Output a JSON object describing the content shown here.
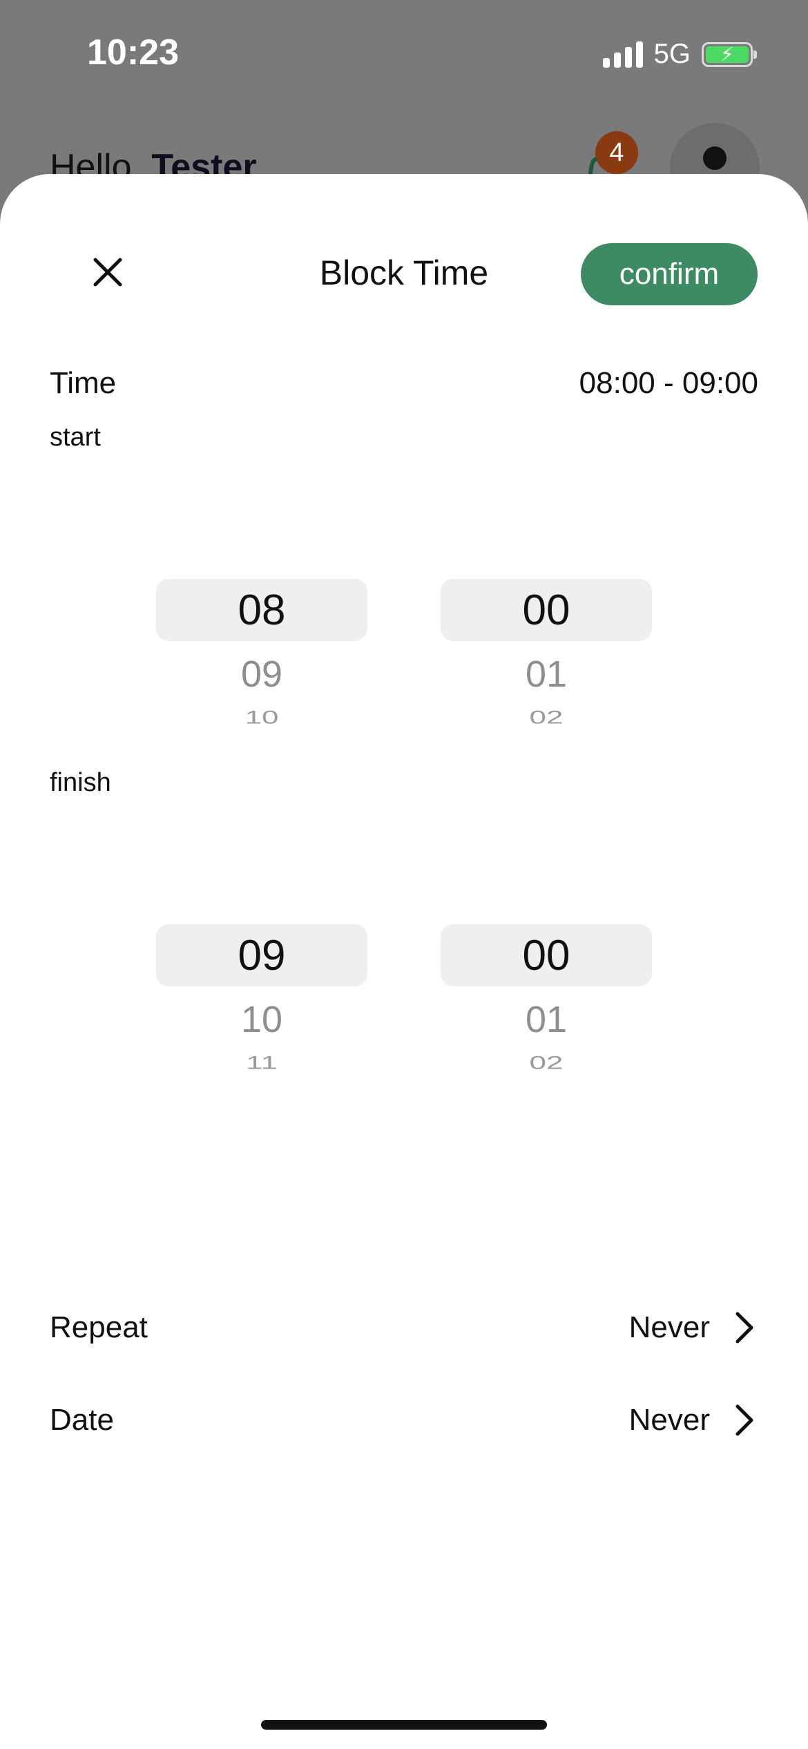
{
  "status_bar": {
    "time": "10:23",
    "network": "5G"
  },
  "background": {
    "greeting_prefix": "Hello, ",
    "greeting_name": "Tester",
    "notification_count": "4"
  },
  "sheet": {
    "title": "Block Time",
    "confirm_label": "confirm",
    "time_label": "Time",
    "time_range": "08:00 - 09:00",
    "start_label": "start",
    "finish_label": "finish",
    "start_picker": {
      "hour": {
        "selected": "08",
        "next1": "09",
        "next2": "10"
      },
      "minute": {
        "selected": "00",
        "next1": "01",
        "next2": "02"
      }
    },
    "finish_picker": {
      "hour": {
        "selected": "09",
        "next1": "10",
        "next2": "11"
      },
      "minute": {
        "selected": "00",
        "next1": "01",
        "next2": "02"
      }
    },
    "repeat": {
      "label": "Repeat",
      "value": "Never"
    },
    "date": {
      "label": "Date",
      "value": "Never"
    }
  },
  "colors": {
    "accent": "#3e8b63",
    "picker_highlight": "#efefef",
    "badge": "#8a3a10"
  },
  "icons": [
    "close-icon",
    "chevron-right-icon",
    "bell-icon",
    "signal-icon",
    "battery-icon"
  ]
}
